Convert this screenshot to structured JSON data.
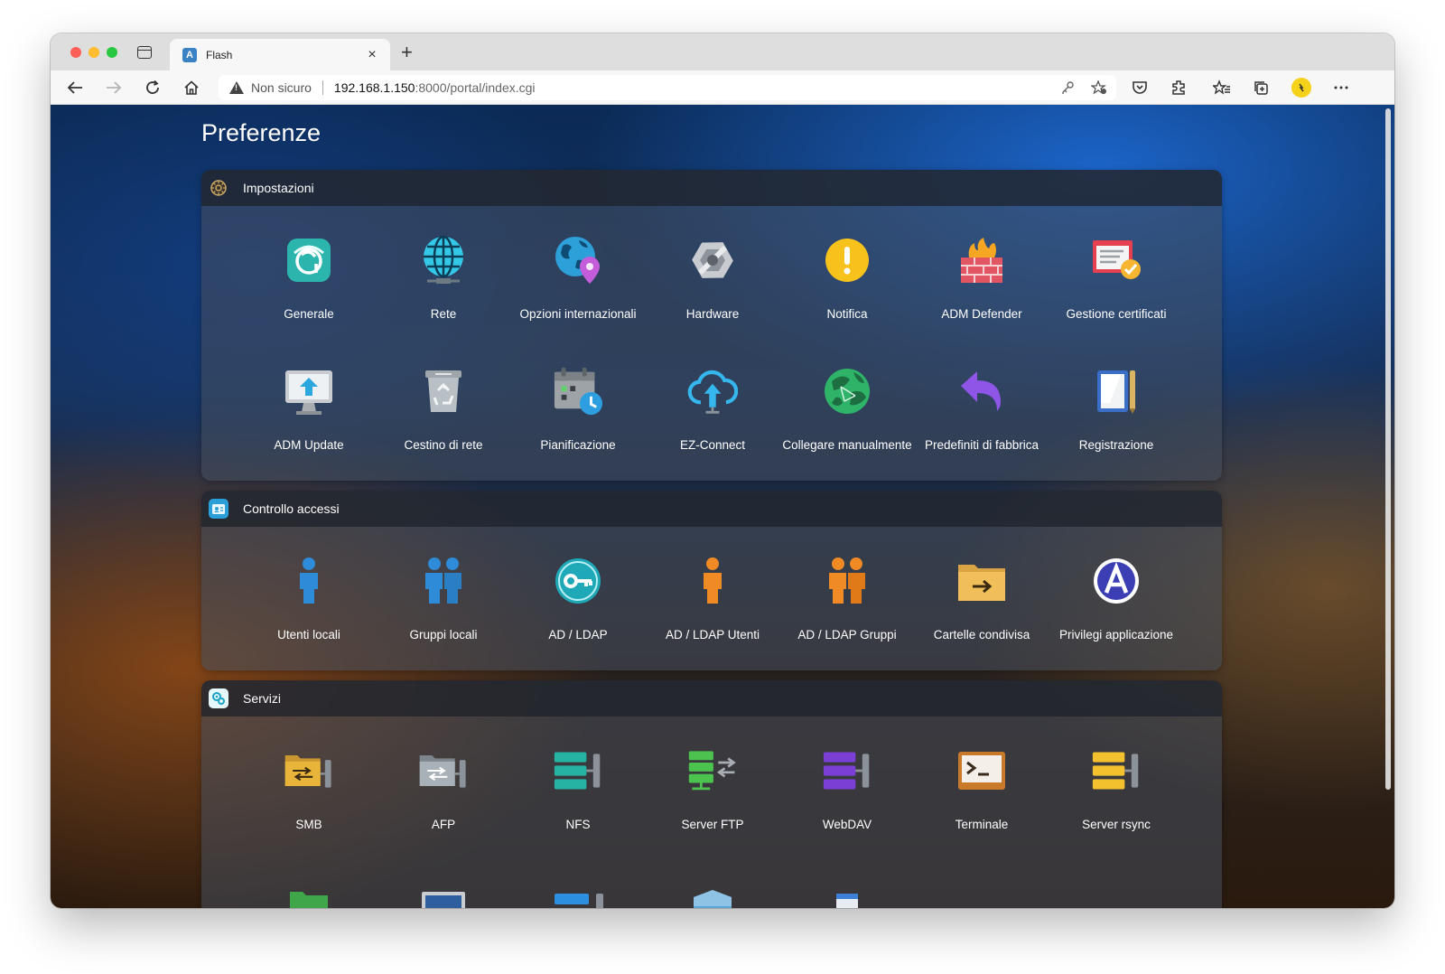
{
  "browser": {
    "tab_title": "Flash",
    "tab_favicon_text": "A",
    "security_label": "Non sicuro",
    "url_host": "192.168.1.150",
    "url_rest": ":8000/portal/index.cgi",
    "new_tab_glyph": "+",
    "close_glyph": "×"
  },
  "page": {
    "title": "Preferenze"
  },
  "sections": [
    {
      "title": "Impostazioni",
      "items": [
        {
          "label": "Generale"
        },
        {
          "label": "Rete"
        },
        {
          "label": "Opzioni internazionali"
        },
        {
          "label": "Hardware"
        },
        {
          "label": "Notifica"
        },
        {
          "label": "ADM Defender"
        },
        {
          "label": "Gestione certificati"
        },
        {
          "label": "ADM Update"
        },
        {
          "label": "Cestino di rete"
        },
        {
          "label": "Pianificazione"
        },
        {
          "label": "EZ-Connect"
        },
        {
          "label": "Collegare manualmente"
        },
        {
          "label": "Predefiniti di fabbrica"
        },
        {
          "label": "Registrazione"
        }
      ]
    },
    {
      "title": "Controllo accessi",
      "items": [
        {
          "label": "Utenti locali"
        },
        {
          "label": "Gruppi locali"
        },
        {
          "label": "AD / LDAP"
        },
        {
          "label": "AD / LDAP Utenti"
        },
        {
          "label": "AD / LDAP Gruppi"
        },
        {
          "label": "Cartelle condivisa"
        },
        {
          "label": "Privilegi applicazione"
        }
      ]
    },
    {
      "title": "Servizi",
      "items": [
        {
          "label": "SMB"
        },
        {
          "label": "AFP"
        },
        {
          "label": "NFS"
        },
        {
          "label": "Server FTP"
        },
        {
          "label": "WebDAV"
        },
        {
          "label": "Terminale"
        },
        {
          "label": "Server rsync"
        }
      ]
    }
  ]
}
